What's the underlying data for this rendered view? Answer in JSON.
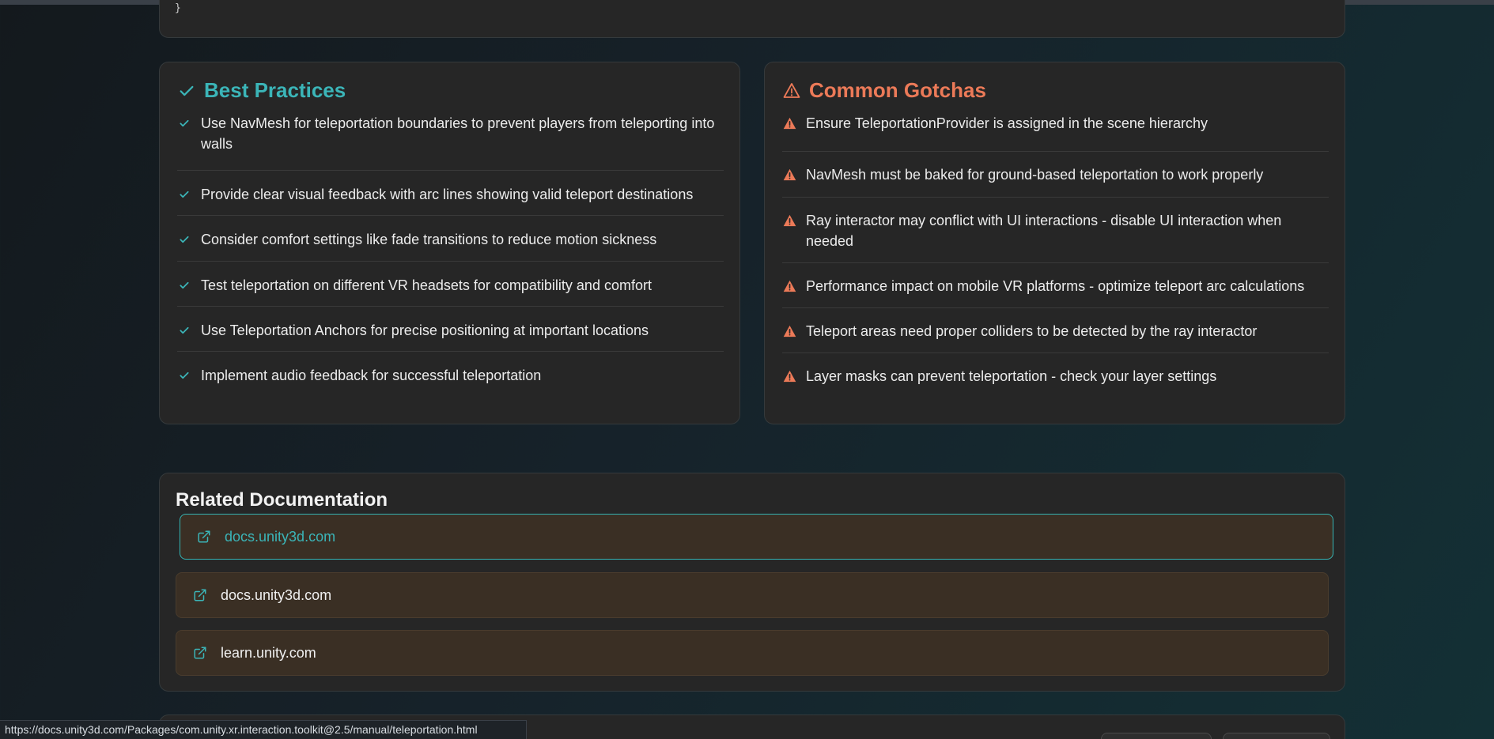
{
  "code_block": {
    "closing_brace": "}"
  },
  "best_practices": {
    "title": "Best Practices",
    "icon": "check-icon",
    "accent": "#3bb5b8",
    "items": [
      "Use NavMesh for teleportation boundaries to prevent players from teleporting into walls",
      "Provide clear visual feedback with arc lines showing valid teleport destinations",
      "Consider comfort settings like fade transitions to reduce motion sickness",
      "Test teleportation on different VR headsets for compatibility and comfort",
      "Use Teleportation Anchors for precise positioning at important locations",
      "Implement audio feedback for successful teleportation"
    ]
  },
  "common_gotchas": {
    "title": "Common Gotchas",
    "icon": "warning-triangle-icon",
    "accent": "#ec7a58",
    "items": [
      "Ensure TeleportationProvider is assigned in the scene hierarchy",
      "NavMesh must be baked for ground-based teleportation to work properly",
      "Ray interactor may conflict with UI interactions - disable UI interaction when needed",
      "Performance impact on mobile VR platforms - optimize teleport arc calculations",
      "Teleport areas need proper colliders to be detected by the ray interactor",
      "Layer masks can prevent teleportation - check your layer settings"
    ]
  },
  "related_docs": {
    "title": "Related Documentation",
    "links": [
      {
        "label": "docs.unity3d.com",
        "icon": "external-link-icon",
        "hovered": true
      },
      {
        "label": "docs.unity3d.com",
        "icon": "external-link-icon",
        "hovered": false
      },
      {
        "label": "learn.unity.com",
        "icon": "external-link-icon",
        "hovered": false
      }
    ]
  },
  "status_bar": {
    "url": "https://docs.unity3d.com/Packages/com.unity.xr.interaction.toolkit@2.5/manual/teleportation.html"
  }
}
